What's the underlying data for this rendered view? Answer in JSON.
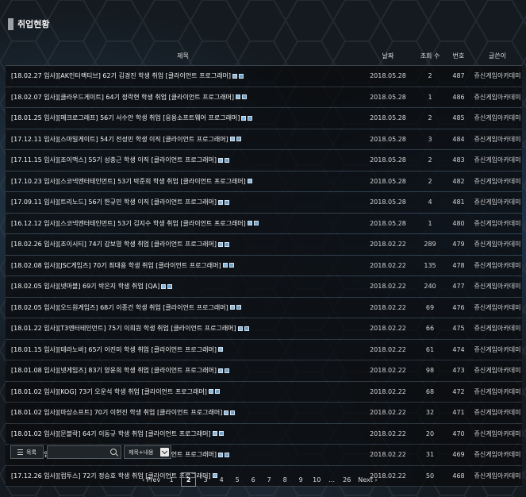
{
  "page_title": "취업현황",
  "columns": {
    "subject": "제목",
    "date": "날짜",
    "views": "조회 수",
    "num": "번호",
    "author": "글쓴이"
  },
  "rows": [
    {
      "subject": "[18.02.27 입사][AK인터랙티브] 62기 김경진 학생 취업 [클라이언트 프로그래머]",
      "date": "2018.05.28",
      "views": "2",
      "num": "487",
      "author": "쥬신게임아카데미"
    },
    {
      "subject": "[18.02.07 입사][클라우드게이트] 64기 정락현 학생 취업 [클라이언트 프로그래머]",
      "date": "2018.05.28",
      "views": "1",
      "num": "486",
      "author": "쥬신게임아카데미"
    },
    {
      "subject": "[18.01.25 입사][메크로그래프] 56기 서수안 학생 취업 [응용소프트웨어 프로그래머]",
      "date": "2018.05.28",
      "views": "2",
      "num": "485",
      "author": "쥬신게임아카데미"
    },
    {
      "subject": "[17.12.11 입사][스마일게이트] 54기 전성민 학생 이직 [클라이언트 프로그래머]",
      "date": "2018.05.28",
      "views": "3",
      "num": "484",
      "author": "쥬신게임아카데미"
    },
    {
      "subject": "[17.11.15 입사][조이맥스] 55기 성충근 학생 이직 [클라이언트 프로그래머]",
      "date": "2018.05.28",
      "views": "2",
      "num": "483",
      "author": "쥬신게임아카데미"
    },
    {
      "subject": "[17.10.23 입사][스코넥엔터테인먼트] 53기 박준희 학생 취업 [클라이언트 프로그래머]",
      "date": "2018.05.28",
      "views": "2",
      "num": "482",
      "author": "쥬신게임아카데미"
    },
    {
      "subject": "[17.09.11 입사][트리노드] 56기 한규민 학생 이직 [클라이언트 프로그래머]",
      "date": "2018.05.28",
      "views": "4",
      "num": "481",
      "author": "쥬신게임아카데미"
    },
    {
      "subject": "[16.12.12 입사][스코넥엔터테인먼트] 53기 김지수 학생 취업 [클라이언트 프로그래머]",
      "date": "2018.05.28",
      "views": "1",
      "num": "480",
      "author": "쥬신게임아카데미"
    },
    {
      "subject": "[18.02.26 입사][조이시티] 74기 강보영 학생 취업 [클라이언트 프로그래머]",
      "date": "2018.02.22",
      "views": "289",
      "num": "479",
      "author": "쥬신게임아카데미"
    },
    {
      "subject": "[18.02.08 입사][JSC게임즈] 70기 최대용 학생 취업 [클라이언트 프로그래머]",
      "date": "2018.02.22",
      "views": "135",
      "num": "478",
      "author": "쥬신게임아카데미"
    },
    {
      "subject": "[18.02.05 입사][넷마블] 69기 박은지 학생 취업 [QA]",
      "date": "2018.02.22",
      "views": "240",
      "num": "477",
      "author": "쥬신게임아카데미"
    },
    {
      "subject": "[18.02.05 입사][오드원게임즈] 68기 이종건 학생 취업 [클라이언트 프로그래머]",
      "date": "2018.02.22",
      "views": "69",
      "num": "476",
      "author": "쥬신게임아카데미"
    },
    {
      "subject": "[18.01.22 입사][T3엔터테인먼트] 75기 이희원 학생 취업 [클라이언트 프로그래머]",
      "date": "2018.02.22",
      "views": "66",
      "num": "475",
      "author": "쥬신게임아카데미"
    },
    {
      "subject": "[18.01.15 입사][테라노바] 65기 이진미 학생 취업 [클라이언트 프로그래머]",
      "date": "2018.02.22",
      "views": "61",
      "num": "474",
      "author": "쥬신게임아카데미"
    },
    {
      "subject": "[18.01.08 입사][넷게임즈] 83기 양윤희 학생 취업 [클라이언트 프로그래머]",
      "date": "2018.02.22",
      "views": "98",
      "num": "473",
      "author": "쥬신게임아카데미"
    },
    {
      "subject": "[18.01.02 입사][KOG] 73기 오운석 학생 취업 [클라이언트 프로그래머]",
      "date": "2018.02.22",
      "views": "68",
      "num": "472",
      "author": "쥬신게임아카데미"
    },
    {
      "subject": "[18.01.02 입사][마상소프트] 70기 이현진 학생 취업 [클라이언트 프로그래머]",
      "date": "2018.02.22",
      "views": "32",
      "num": "471",
      "author": "쥬신게임아카데미"
    },
    {
      "subject": "[18.01.02 입사][문블락] 64기 이동규 학생 취업 [클라이언트 프로그래머]",
      "date": "2018.02.22",
      "views": "20",
      "num": "470",
      "author": "쥬신게임아카데미"
    },
    {
      "subject": "[17.12.27 입사][위메이드] 72기 탁성우 학생 취업 [클라이언트 프로그래머]",
      "date": "2018.02.22",
      "views": "31",
      "num": "469",
      "author": "쥬신게임아카데미"
    },
    {
      "subject": "[17.12.26 입사][컴투스] 72기 정승호 학생 취업 [클라이언트 프로그래머]",
      "date": "2018.02.22",
      "views": "50",
      "num": "468",
      "author": "쥬신게임아카데미"
    }
  ],
  "row_icons": [
    2,
    2,
    2,
    2,
    2,
    1,
    2,
    2,
    2,
    2,
    2,
    2,
    2,
    1,
    2,
    2,
    2,
    2,
    2,
    1
  ],
  "controls": {
    "list_label": "목록",
    "search_placeholder": "",
    "search_scope": "제목+내용"
  },
  "pagination": {
    "prev": "‹ Prev",
    "next": "Next ›",
    "pages": [
      "1",
      "2",
      "3",
      "4",
      "5",
      "6",
      "7",
      "8",
      "9",
      "10"
    ],
    "current": "2",
    "ellipsis": "...",
    "last": "26"
  },
  "icons": {
    "title_marker": "bar-marker-icon",
    "file": "file-attachment-icon",
    "list": "list-icon",
    "search": "search-icon",
    "dropdown": "chevron-down-icon"
  }
}
